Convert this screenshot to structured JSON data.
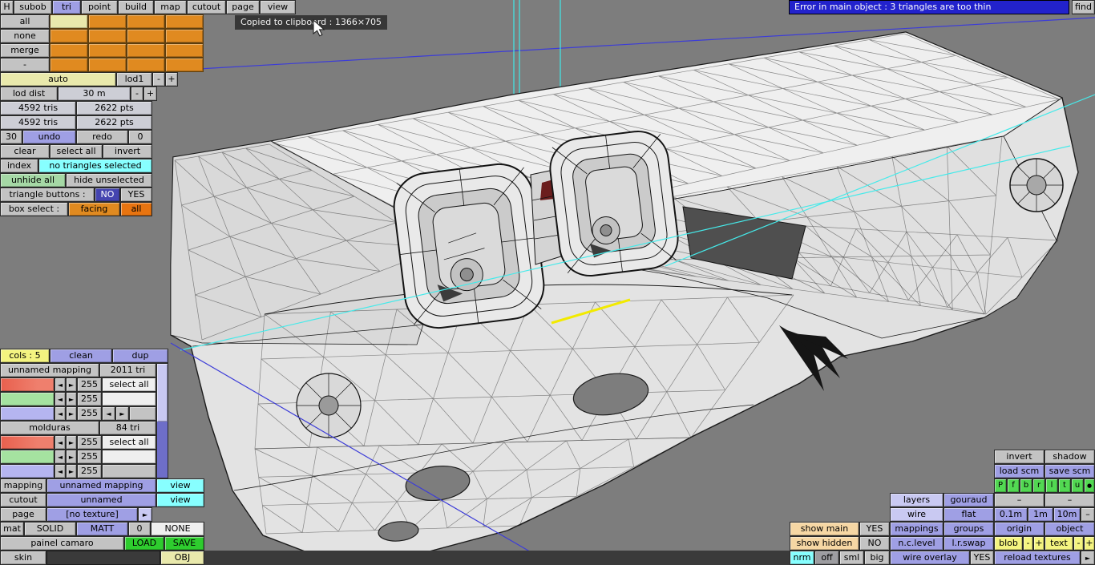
{
  "colors": {
    "canvas-bg": "#7d7d7d",
    "btn": "#c3c3c3",
    "btn-dark": "#9d9da1",
    "lavender": "#9f9fe4",
    "lavender-light": "#c9c9f2",
    "cyan": "#87ffff",
    "orange": "#e08a20",
    "orange-sel": "#e87410",
    "yellow": "#f4f480",
    "pale-yellow": "#e9e9ac",
    "cream": "#f6d7a4",
    "green": "#2ecc2e",
    "green-cell": "#52d852",
    "light-green": "#a5d8a5",
    "sel-blue": "#4444b0",
    "banner-blue": "#2222cc",
    "slider-red": "#ef7f6d",
    "slider-green": "#a5e2a0",
    "slider-lav": "#b5b5f0",
    "dark-bar": "#3a3a3a"
  },
  "topbar": {
    "buttons": [
      "H",
      "subob",
      "tri",
      "point",
      "build",
      "map",
      "cutout",
      "page",
      "view"
    ],
    "error_text": "Error in main object : 3 triangles are too thin",
    "find": "find"
  },
  "tooltip": {
    "text": "Copied to clipboard : 1366×705"
  },
  "subobject": {
    "buttons": [
      "all",
      "none",
      "merge",
      "-"
    ]
  },
  "lod": {
    "auto": "auto",
    "level": "lod1",
    "minus": "-",
    "plus": "+",
    "dist_label": "lod dist",
    "dist_value": "30 m"
  },
  "stats": {
    "tris1": "4592 tris",
    "pts1": "2622 pts",
    "tris2": "4592 tris",
    "pts2": "2622 pts"
  },
  "history": {
    "undo_steps": "30",
    "undo": "undo",
    "redo": "redo",
    "redo_steps": "0"
  },
  "selection": {
    "clear": "clear",
    "select_all": "select all",
    "invert": "invert",
    "index": "index",
    "status": "no triangles selected",
    "unhide_all": "unhide all",
    "hide_unselected": "hide unselected",
    "triangle_buttons_label": "triangle buttons :",
    "no": "NO",
    "yes": "YES",
    "box_select_label": "box select :",
    "facing": "facing",
    "all": "all"
  },
  "mapping_panel": {
    "cols": "cols : 5",
    "clean": "clean",
    "dup": "dup",
    "arrow_left": "◄",
    "arrow_right": "►",
    "groups": [
      {
        "name": "unnamed mapping",
        "tris": "2011 tri",
        "r": "255",
        "g": "255",
        "b": "255",
        "select_all": "select all"
      },
      {
        "name": "molduras",
        "tris": "84 tri",
        "r": "255",
        "g": "255",
        "b": "255",
        "select_all": "select all"
      }
    ]
  },
  "bottom_left": {
    "mapping_label": "mapping",
    "mapping_value": "unnamed mapping",
    "mapping_view": "view",
    "cutout_label": "cutout",
    "cutout_value": "unnamed",
    "cutout_view": "view",
    "page_label": "page",
    "page_value": "[no texture]",
    "mat_label": "mat",
    "solid": "SOLID",
    "matt": "MATT",
    "zero": "0",
    "none": "NONE",
    "file_name": "painel camaro",
    "load": "LOAD",
    "save": "SAVE",
    "skin_label": "skin",
    "obj": "OBJ"
  },
  "bottom_right": {
    "invert": "invert",
    "shadow": "shadow",
    "load_scm": "load scm",
    "save_scm": "save scm",
    "view_buttons": [
      "P",
      "f",
      "b",
      "r",
      "l",
      "t",
      "u",
      "●"
    ],
    "layers": "layers",
    "gouraud": "gouraud",
    "dash": "–",
    "wire": "wire",
    "flat": "flat",
    "m_01": "0.1m",
    "m_1": "1m",
    "m_10": "10m",
    "show_main": "show main",
    "yes": "YES",
    "mappings": "mappings",
    "groups": "groups",
    "origin": "origin",
    "object": "object",
    "show_hidden": "show hidden",
    "no": "NO",
    "nc_level": "n.c.level",
    "lr_swap": "l.r.swap",
    "blob": "blob",
    "minus": "-",
    "plus": "+",
    "text": "text",
    "nrm": "nrm",
    "off": "off",
    "sml": "sml",
    "big": "big",
    "wire_overlay": "wire overlay",
    "reload_textures": "reload textures",
    "arrow": "►"
  }
}
